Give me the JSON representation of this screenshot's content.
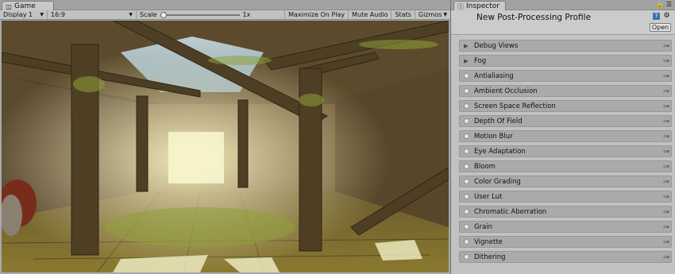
{
  "game": {
    "tab_label": "Game",
    "tab_icon": "game-controller-icon",
    "display": "Display 1",
    "aspect": "16:9",
    "scale_label": "Scale",
    "scale_value": "1x",
    "scale_fraction": 0.0,
    "buttons": {
      "maximize": "Maximize On Play",
      "mute": "Mute Audio",
      "stats": "Stats",
      "gizmos": "Gizmos"
    }
  },
  "inspector": {
    "tab_label": "Inspector",
    "tab_icon": "info-icon",
    "title": "New Post-Processing Profile",
    "open_label": "Open",
    "effects": [
      {
        "label": "Debug Views",
        "kind": "foldout"
      },
      {
        "label": "Fog",
        "kind": "foldout"
      },
      {
        "label": "Antialiasing",
        "kind": "toggle"
      },
      {
        "label": "Ambient Occlusion",
        "kind": "toggle"
      },
      {
        "label": "Screen Space Reflection",
        "kind": "toggle"
      },
      {
        "label": "Depth Of Field",
        "kind": "toggle"
      },
      {
        "label": "Motion Blur",
        "kind": "toggle"
      },
      {
        "label": "Eye Adaptation",
        "kind": "toggle"
      },
      {
        "label": "Bloom",
        "kind": "toggle"
      },
      {
        "label": "Color Grading",
        "kind": "toggle"
      },
      {
        "label": "User Lut",
        "kind": "toggle"
      },
      {
        "label": "Chromatic Aberration",
        "kind": "toggle"
      },
      {
        "label": "Grain",
        "kind": "toggle"
      },
      {
        "label": "Vignette",
        "kind": "toggle"
      },
      {
        "label": "Dithering",
        "kind": "toggle"
      }
    ]
  },
  "colors": {
    "panel_bg": "#c2c2c2",
    "effect_row": "#aaaaaa",
    "toolbar": "#c2c2c2"
  }
}
